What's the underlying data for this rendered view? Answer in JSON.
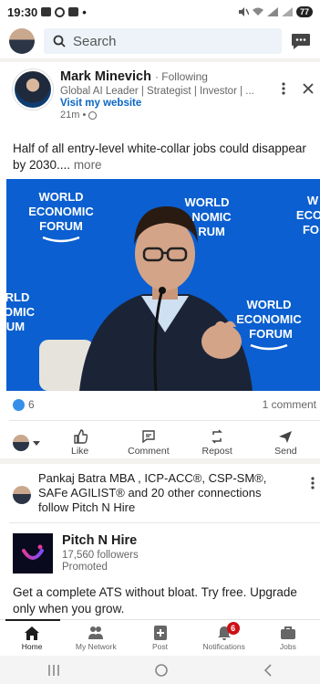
{
  "status_bar": {
    "time": "19:30",
    "dot": "•",
    "battery": "77"
  },
  "top_bar": {
    "search_label": "Search"
  },
  "post": {
    "author_name": "Mark Minevich",
    "following_label": "· Following",
    "headline": "Global AI Leader | Strategist | Investor | ...",
    "website_label": "Visit my website",
    "time_ago": "21m •",
    "text": "Half of all entry-level white-collar jobs could disappear by 2030....",
    "see_more": "more",
    "image_banners": {
      "top_left": [
        "WORLD",
        "ECONOMIC",
        "FORUM"
      ],
      "top_center": [
        "WORLD",
        "NOMIC",
        "RUM"
      ],
      "top_right": [
        "W",
        "ECO",
        "FO"
      ],
      "mid_left": [
        "RLD",
        "OMIC",
        "UM"
      ],
      "bottom_right": [
        "WORLD",
        "ECONOMIC",
        "FORUM"
      ]
    },
    "reaction_count": "6",
    "comment_count": "1 comment"
  },
  "actions": {
    "like": "Like",
    "comment": "Comment",
    "repost": "Repost",
    "send": "Send"
  },
  "ad": {
    "social_text": "Pankaj Batra MBA , ICP-ACC®, CSP-SM®, SAFe AGILIST® and 20 other connections follow Pitch N Hire",
    "company_name": "Pitch N Hire",
    "followers": "17,560 followers",
    "promoted": "Promoted",
    "text": "Get a complete ATS without bloat. Try free. Upgrade only when you grow."
  },
  "bottom_nav": {
    "home": "Home",
    "network": "My Network",
    "post": "Post",
    "notifications": "Notifications",
    "notifications_badge": "6",
    "jobs": "Jobs"
  },
  "colors": {
    "brand": "#0a66c2",
    "badge": "#cc1016",
    "image_background": "#0b5fd0"
  }
}
